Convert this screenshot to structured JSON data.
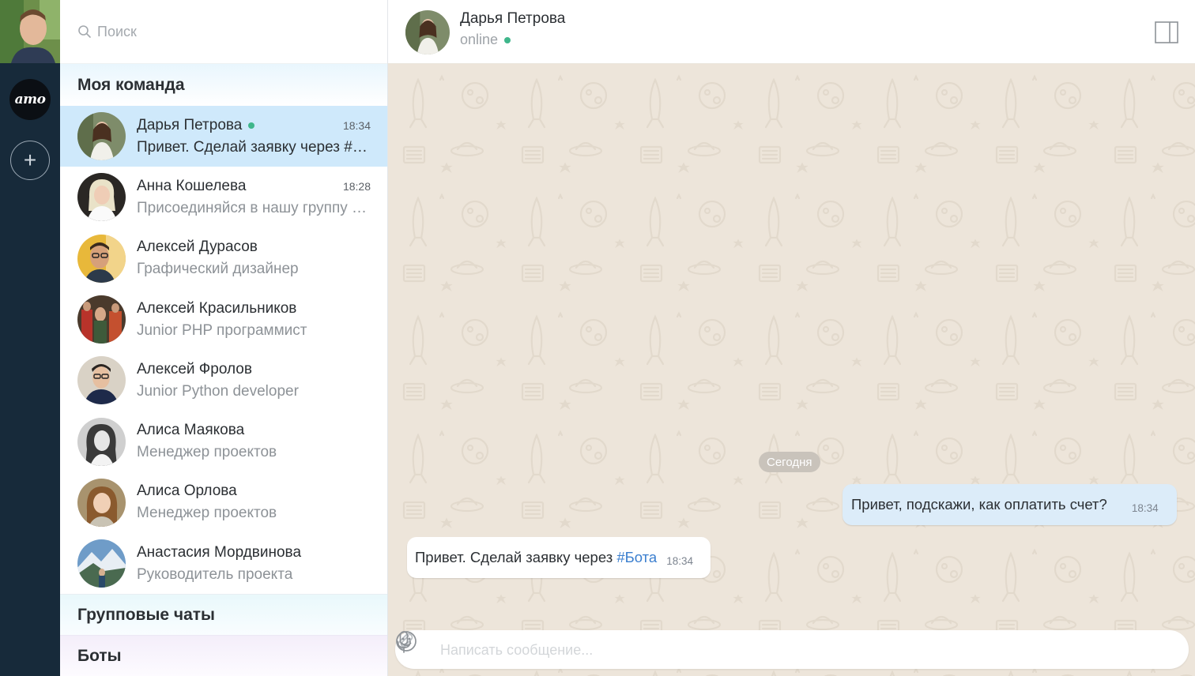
{
  "rail": {
    "brand_label": "amo",
    "add_label": "+"
  },
  "search": {
    "placeholder": "Поиск"
  },
  "sections": {
    "team": "Моя команда",
    "groups": "Групповые чаты",
    "bots": "Боты"
  },
  "contacts": [
    {
      "name": "Дарья Петрова",
      "subtitle": "Привет. Сделай заявку через #Бота",
      "time": "18:34",
      "online": true,
      "active": true
    },
    {
      "name": "Анна Кошелева",
      "subtitle": "Присоединяйся в нашу группу в телеграм",
      "time": "18:28"
    },
    {
      "name": "Алексей Дурасов",
      "subtitle": "Графический дизайнер",
      "time": ""
    },
    {
      "name": "Алексей Красильников",
      "subtitle": "Junior PHP программист",
      "time": ""
    },
    {
      "name": "Алексей Фролов",
      "subtitle": "Junior Python developer",
      "time": ""
    },
    {
      "name": "Алиса Маякова",
      "subtitle": "Менеджер проектов",
      "time": ""
    },
    {
      "name": "Алиса Орлова",
      "subtitle": "Менеджер проектов",
      "time": ""
    },
    {
      "name": "Анастасия Мордвинова",
      "subtitle": "Руководитель проекта",
      "time": ""
    }
  ],
  "chat": {
    "name": "Дарья Петрова",
    "status": "online",
    "date_divider": "Сегодня",
    "messages": [
      {
        "direction": "out",
        "text": "Привет, подскажи, как оплатить счет?",
        "time": "18:34"
      },
      {
        "direction": "in",
        "text": "Привет. Сделай заявку через ",
        "hashtag": "#Бота",
        "time": "18:34"
      }
    ],
    "composer_placeholder": "Написать сообщение..."
  },
  "colors": {
    "rail_bg": "#172a3a",
    "active_row": "#cfe9fb",
    "online": "#3fb68b",
    "chat_bg": "#ede5da",
    "outgoing_bubble": "#dcecf9",
    "hashtag": "#3b7fcf"
  },
  "icons": [
    "search-icon",
    "plus-icon",
    "panel-toggle-icon",
    "paperclip-icon",
    "smile-icon",
    "microphone-icon"
  ]
}
